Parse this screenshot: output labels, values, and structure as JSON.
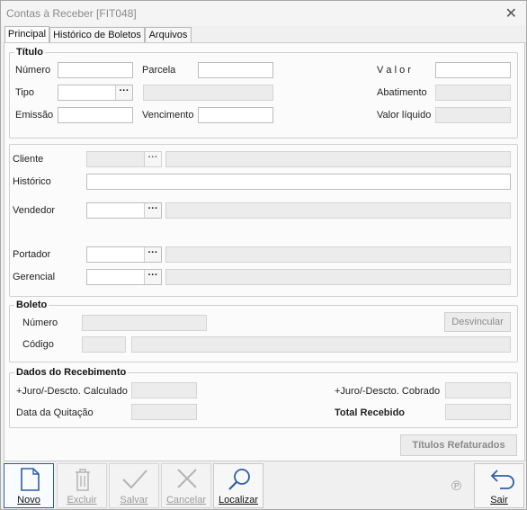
{
  "window": {
    "title": "Contas à Receber [FIT048]",
    "close_glyph": "✕"
  },
  "tabs": [
    {
      "label": "Principal"
    },
    {
      "label": "Histórico de Boletos"
    },
    {
      "label": "Arquivos"
    }
  ],
  "titulo": {
    "group_label": "Título",
    "numero": "Número",
    "parcela": "Parcela",
    "valor": "V a l o r",
    "tipo": "Tipo",
    "abatimento": "Abatimento",
    "emissao": "Emissão",
    "vencimento": "Vencimento",
    "valor_liquido": "Valor líquido"
  },
  "cliente": {
    "cliente": "Cliente",
    "historico": "Histórico",
    "vendedor": "Vendedor",
    "portador": "Portador",
    "gerencial": "Gerencial"
  },
  "boleto": {
    "group_label": "Boleto",
    "numero": "Número",
    "codigo": "Código",
    "desvincular": "Desvincular"
  },
  "recebimento": {
    "group_label": "Dados do Recebimento",
    "juro_calculado": "+Juro/-Descto. Calculado",
    "juro_cobrado": "+Juro/-Descto. Cobrado",
    "data_quitacao": "Data da Quitação",
    "total_recebido": "Total Recebido"
  },
  "titulos_refaturados": "Títulos Refaturados",
  "toolbar": {
    "novo": "Novo",
    "excluir": "Excluir",
    "salvar": "Salvar",
    "cancelar": "Cancelar",
    "localizar": "Localizar",
    "sair": "Sair",
    "status_glyph": "℗"
  },
  "ellipsis": "···"
}
